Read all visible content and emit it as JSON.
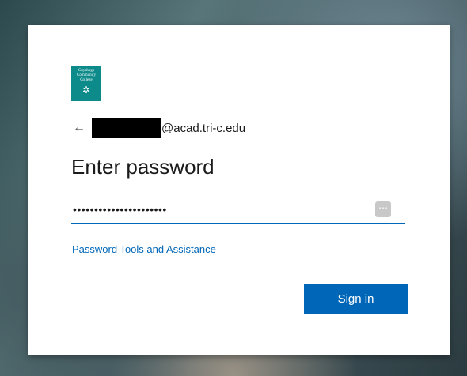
{
  "logo": {
    "lines": [
      "Cuyahoga",
      "Community",
      "College"
    ],
    "icon": "snowflake-icon",
    "color": "#0d8a8a"
  },
  "account": {
    "email_suffix": "@acad.tri-c.edu",
    "back_icon": "←"
  },
  "title": "Enter password",
  "password": {
    "masked_value": "••••••••••••••••••••••",
    "reveal_icon": "⋯"
  },
  "help_link": "Password Tools and Assistance",
  "signin_label": "Sign in",
  "colors": {
    "accent": "#0067b8"
  }
}
